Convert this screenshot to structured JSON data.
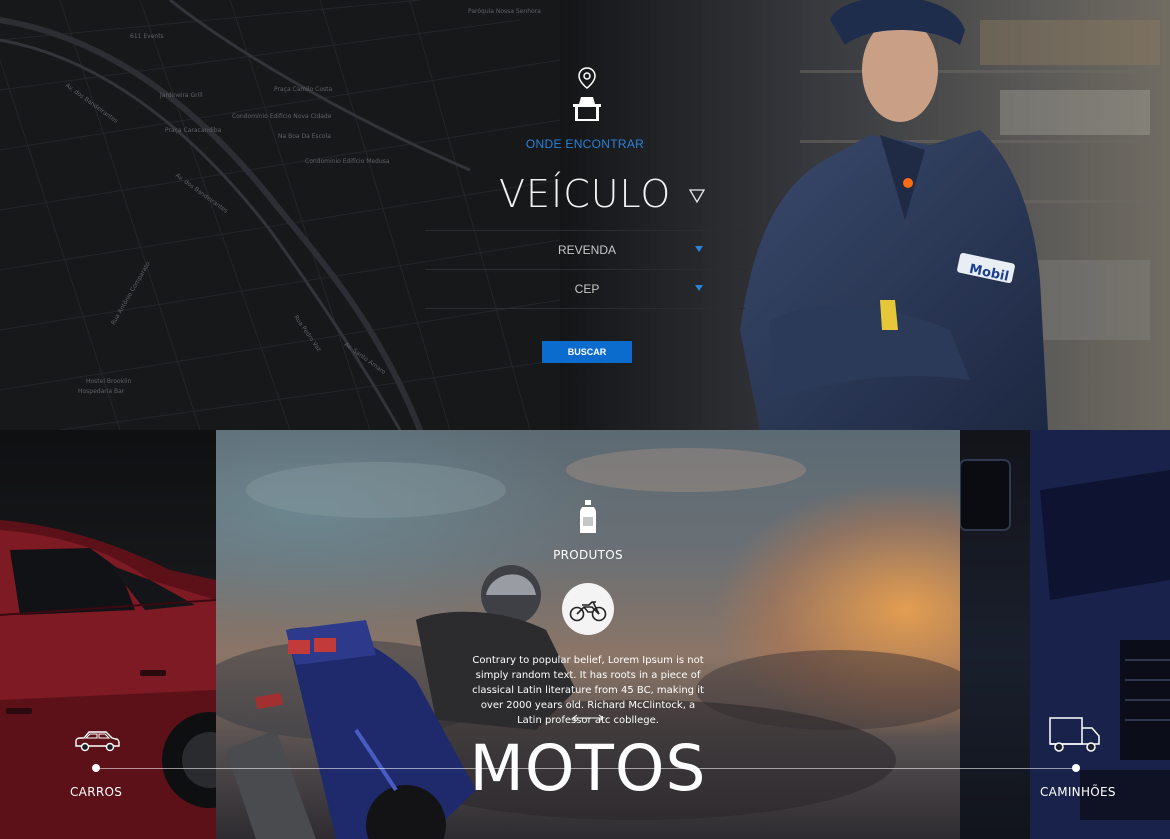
{
  "map": {
    "labels": [
      "611 Events",
      "Av. dos Bandeirantes",
      "Jardineira Grill",
      "Praça Camilo Costa",
      "Condomínio Edifício Nova Cidade",
      "Praça Caracandiba",
      "Na Boa Da Escola",
      "Condomínio Edifício Medusa",
      "Av. dos Bandeirantes",
      "Paróquia Nossa Senhora",
      "Hostel Brooklin",
      "Hospedaria Bar",
      "Rua Pedro Vaz",
      "Rua Antônio Comparato",
      "Av. Santo Amaro"
    ]
  },
  "search": {
    "heading": "ONDE ENCONTRAR",
    "selected_type": "VEÍCULO",
    "dropdowns": [
      {
        "label": "REVENDA"
      },
      {
        "label": "CEP"
      }
    ],
    "button_label": "BUSCAR"
  },
  "mechanic": {
    "patch_text": "Mobil"
  },
  "products": {
    "heading": "PRODUTOS",
    "description": "Contrary to popular belief, Lorem Ipsum is not simply random text. It has roots in a piece of classical Latin literature from 45 BC, making it over 2000 years old. Richard McClintock, a Latin professor atc cobllege.",
    "active_category": "MOTOS",
    "categories": [
      {
        "label": "CARROS",
        "icon": "car-icon"
      },
      {
        "label": "MOTOS",
        "icon": "motorcycle-icon"
      },
      {
        "label": "CAMINHÕES",
        "icon": "truck-icon"
      }
    ]
  },
  "colors": {
    "accent": "#0c6ccd",
    "heading_blue": "#2b82d9",
    "background": "#141517"
  }
}
